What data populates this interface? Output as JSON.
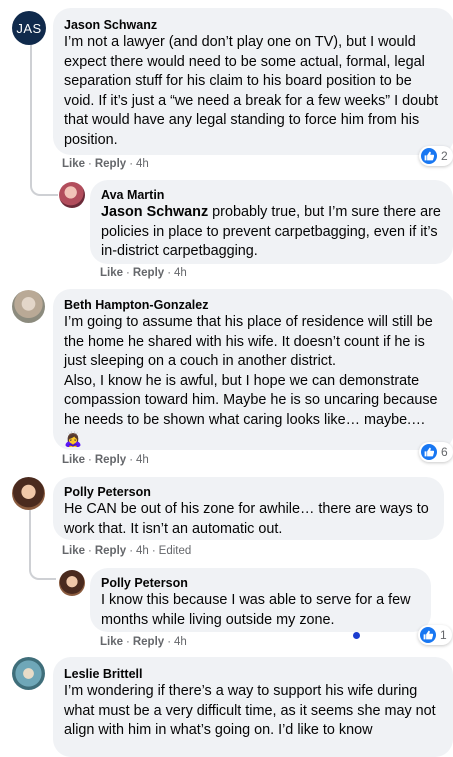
{
  "comments": [
    {
      "author": "Jason Schwanz",
      "avatar_initials": "JAS",
      "text": "I’m not a lawyer (and don’t play one on TV), but I would expect there would need to be some actual, formal, legal separation stuff for his claim to his board position to be void. If it’s just a “we need a break for a few weeks” I doubt that would have any legal standing to force him from his position.",
      "like": "Like",
      "reply": "Reply",
      "time": "4h",
      "reactions": "2"
    },
    {
      "author": "Ava Martin",
      "mention": "Jason Schwanz",
      "text": " probably true, but I’m sure there are policies in place to prevent carpetbagging, even if it’s in-district carpetbagging.",
      "like": "Like",
      "reply": "Reply",
      "time": "4h"
    },
    {
      "author": "Beth Hampton-Gonzalez",
      "text": "I’m going to assume that his place of residence will still be the home he shared with his wife. It doesn’t count if he is just sleeping on a couch in another district.\nAlso, I know he is awful, but I hope we can demonstrate compassion toward him. Maybe he is so uncaring because he needs to be shown what caring looks like… maybe.… 🙇‍♀️",
      "like": "Like",
      "reply": "Reply",
      "time": "4h",
      "reactions": "6"
    },
    {
      "author": "Polly Peterson",
      "text": "He CAN be out of his zone for awhile… there are ways to work that. It isn’t an automatic out.",
      "like": "Like",
      "reply": "Reply",
      "time": "4h",
      "edited": "Edited"
    },
    {
      "author": "Polly Peterson",
      "text": "I know this because I was able to serve for a few months while living outside my zone.",
      "like": "Like",
      "reply": "Reply",
      "time": "4h",
      "reactions": "1"
    },
    {
      "author": "Leslie Brittell",
      "text": "I’m wondering if there’s a way to support his wife during what must be a very difficult time, as it seems she may not align with him in what’s going on. I’d like to know"
    }
  ],
  "colors": {
    "bubble": "#f0f2f5",
    "meta_text": "#65676b",
    "like_blue": "#1877f2",
    "avatar_navy": "#102a4c"
  },
  "icons": [
    "like-icon",
    "avatar"
  ]
}
